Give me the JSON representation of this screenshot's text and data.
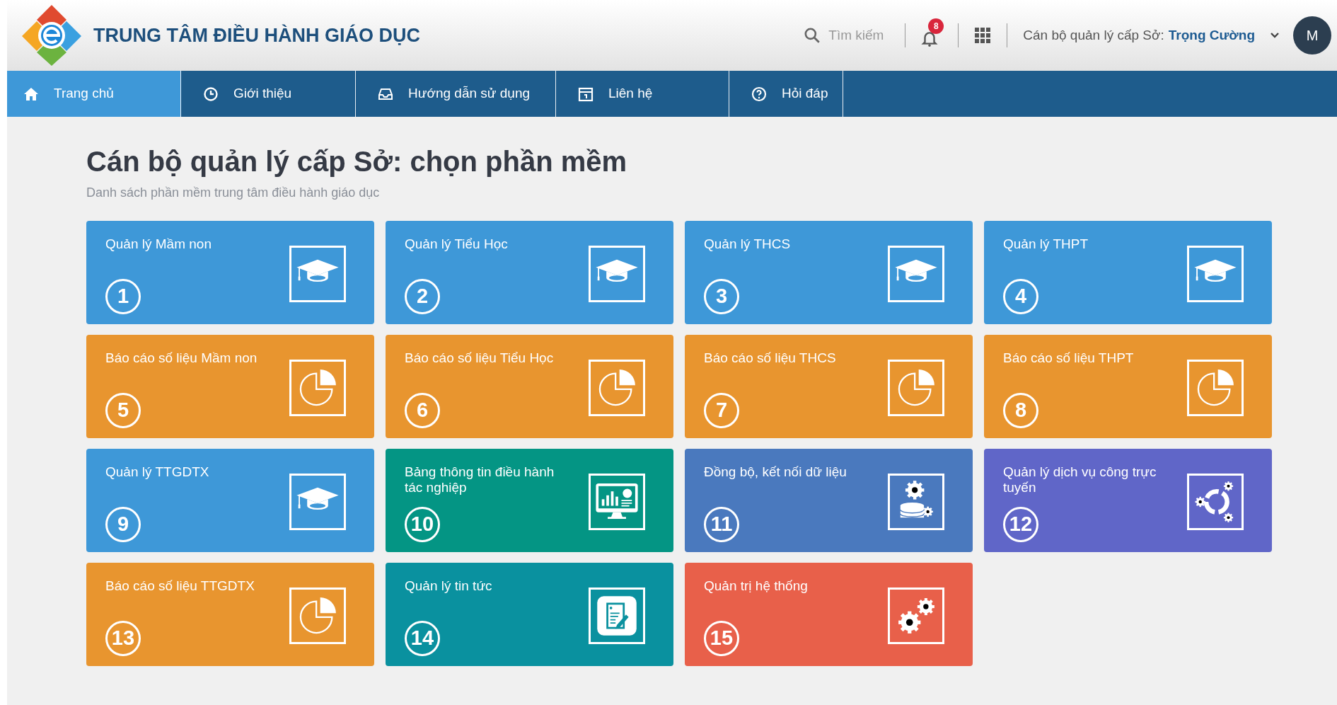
{
  "header": {
    "title": "TRUNG TÂM ĐIỀU HÀNH GIÁO DỤC",
    "search": {
      "placeholder": "Tìm kiếm"
    },
    "notification_count": "8",
    "user_role": "Cán bộ quản lý cấp Sở:",
    "user_name": "Trọng Cường",
    "avatar": "M"
  },
  "nav": [
    {
      "label": "Trang chủ",
      "kind": "home",
      "selected": true
    },
    {
      "label": "Giới thiệu",
      "kind": "clock",
      "selected": false
    },
    {
      "label": "Hướng dẫn sử dụng",
      "kind": "inbox",
      "selected": false
    },
    {
      "label": "Liên hệ",
      "kind": "calendar",
      "selected": false
    },
    {
      "label": "Hỏi đáp",
      "kind": "help",
      "selected": false
    }
  ],
  "page": {
    "title": "Cán bộ quản lý cấp Sở: chọn phần mềm",
    "subtitle": "Danh sách phần mềm trung tâm điều hành giáo dục"
  },
  "tiles": [
    {
      "title": "Quản lý Mầm non",
      "number": "1",
      "color": "#3e98d8",
      "kind": "cap"
    },
    {
      "title": "Quản lý Tiểu Học",
      "number": "2",
      "color": "#3e98d8",
      "kind": "cap"
    },
    {
      "title": "Quản lý THCS",
      "number": "3",
      "color": "#3e98d8",
      "kind": "cap"
    },
    {
      "title": "Quản lý THPT",
      "number": "4",
      "color": "#3e98d8",
      "kind": "cap"
    },
    {
      "title": "Báo cáo số liệu Mầm non",
      "number": "5",
      "color": "#e8952f",
      "kind": "pie"
    },
    {
      "title": "Báo cáo số liệu Tiểu Học",
      "number": "6",
      "color": "#e8952f",
      "kind": "pie"
    },
    {
      "title": "Báo cáo số liệu THCS",
      "number": "7",
      "color": "#e8952f",
      "kind": "pie"
    },
    {
      "title": "Báo cáo số liệu THPT",
      "number": "8",
      "color": "#e8952f",
      "kind": "pie"
    },
    {
      "title": "Quản lý TTGDTX",
      "number": "9",
      "color": "#3e98d8",
      "kind": "cap"
    },
    {
      "title": "Bảng thông tin điều hành tác nghiệp",
      "number": "10",
      "color": "#049584",
      "kind": "monitor"
    },
    {
      "title": "Đồng bộ, kết nối dữ liệu",
      "number": "11",
      "color": "#4a79be",
      "kind": "database"
    },
    {
      "title": "Quản lý dịch vụ công trực tuyến",
      "number": "12",
      "color": "#6066c8",
      "kind": "services"
    },
    {
      "title": "Báo cáo số liệu TTGDTX",
      "number": "13",
      "color": "#e8952f",
      "kind": "pie"
    },
    {
      "title": "Quản lý tin tức",
      "number": "14",
      "color": "#0a919f",
      "kind": "document"
    },
    {
      "title": "Quản trị hệ thống",
      "number": "15",
      "color": "#e8604a",
      "kind": "gears"
    }
  ]
}
